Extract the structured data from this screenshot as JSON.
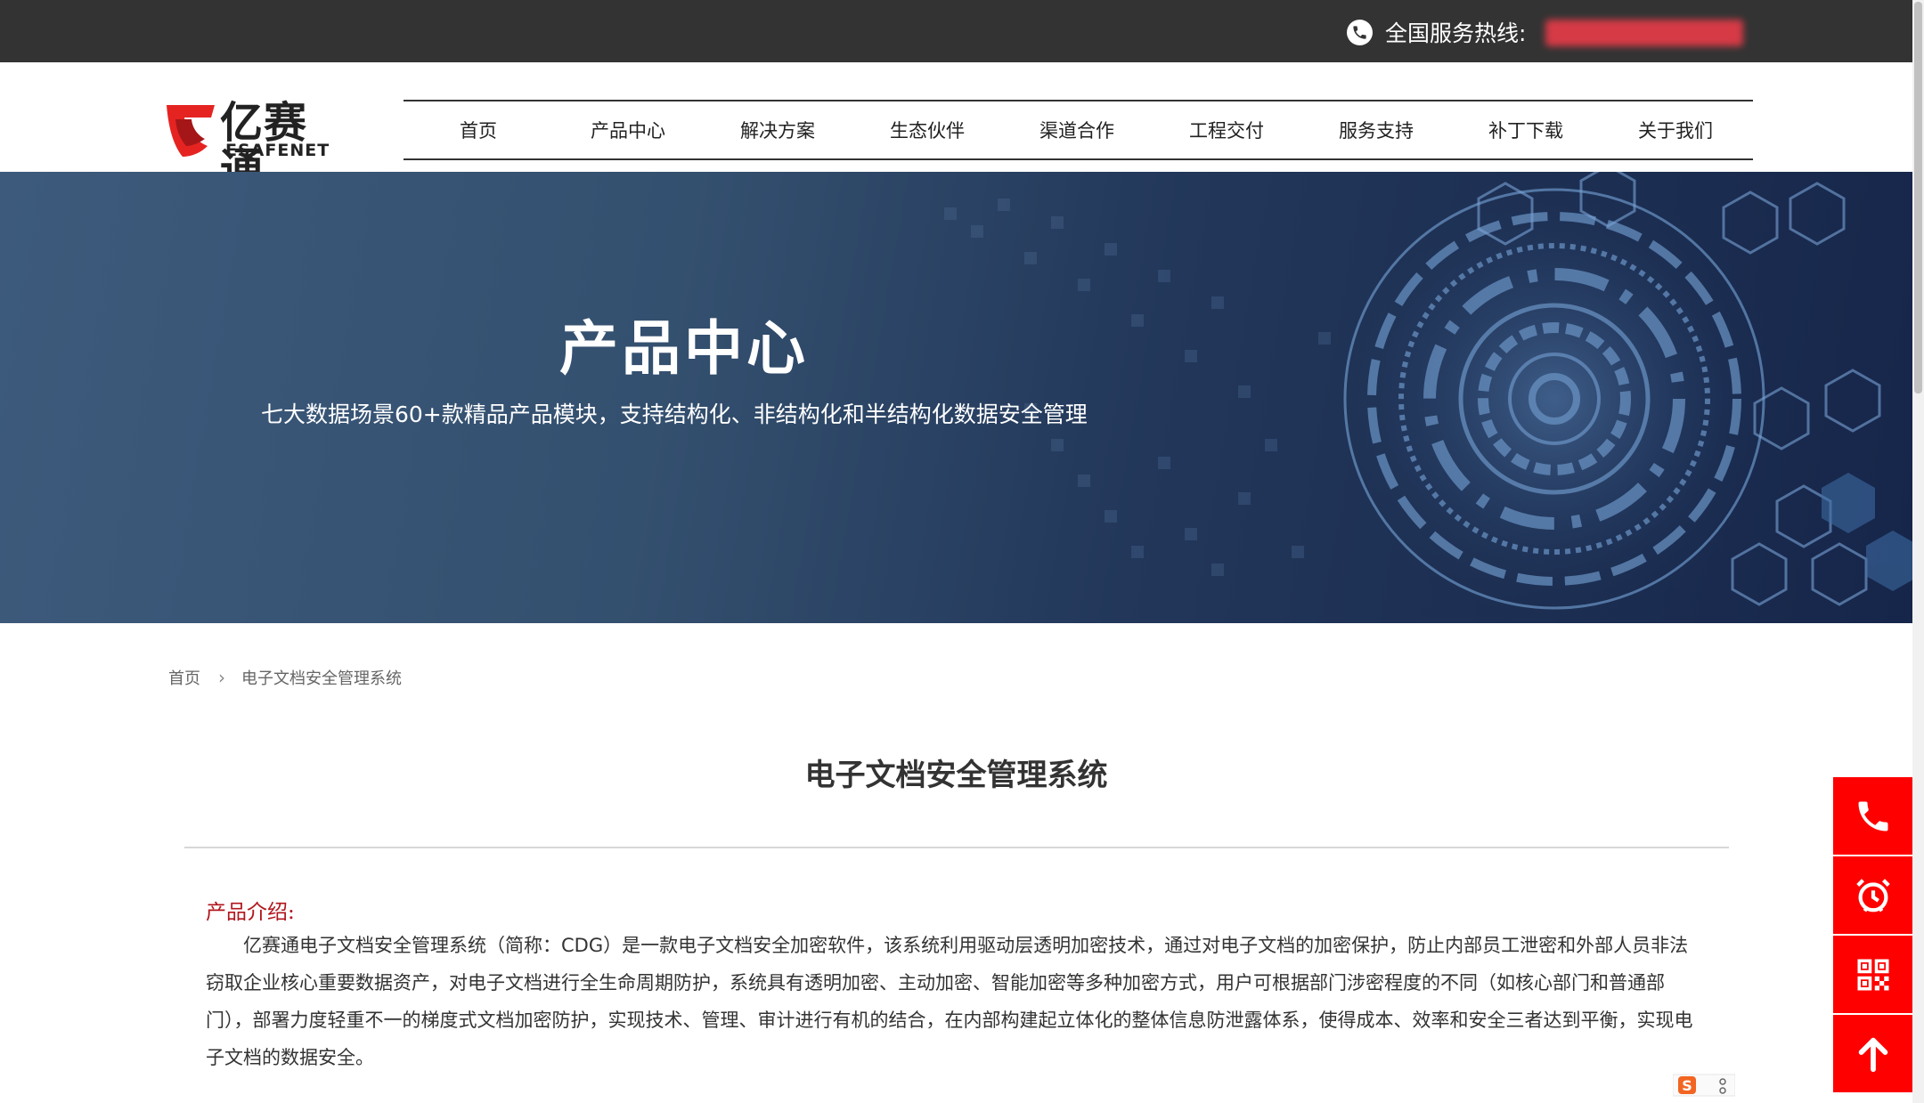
{
  "topbar": {
    "hotline_label": "全国服务热线:",
    "hotline_number": ""
  },
  "logo": {
    "name_cn": "亿赛通",
    "name_en": "ESAFENET",
    "brand_color": "#e52421"
  },
  "nav": {
    "items": [
      "首页",
      "产品中心",
      "解决方案",
      "生态伙伴",
      "渠道合作",
      "工程交付",
      "服务支持",
      "补丁下载",
      "关于我们"
    ]
  },
  "banner": {
    "title": "产品中心",
    "subtitle": "七大数据场景60+款精品产品模块，支持结构化、非结构化和半结构化数据安全管理"
  },
  "breadcrumb": {
    "home": "首页",
    "current": "电子文档安全管理系统"
  },
  "page": {
    "title": "电子文档安全管理系统",
    "intro_label": "产品介绍:",
    "intro_text": "亿赛通电子文档安全管理系统（简称：CDG）是一款电子文档安全加密软件，该系统利用驱动层透明加密技术，通过对电子文档的加密保护，防止内部员工泄密和外部人员非法窃取企业核心重要数据资产，对电子文档进行全生命周期防护，系统具有透明加密、主动加密、智能加密等多种加密方式，用户可根据部门涉密程度的不同（如核心部门和普通部门），部署力度轻重不一的梯度式文档加密防护，实现技术、管理、审计进行有机的结合，在内部构建起立体化的整体信息防泄露体系，使得成本、效率和安全三者达到平衡，实现电子文档的数据安全。"
  },
  "float_bar": {
    "buttons": [
      "phone-icon",
      "alarm-clock-icon",
      "qr-code-icon",
      "arrow-up-icon"
    ],
    "color": "#ff0000"
  },
  "colors": {
    "topbar": "#333333",
    "accent_red": "#b1151c"
  }
}
